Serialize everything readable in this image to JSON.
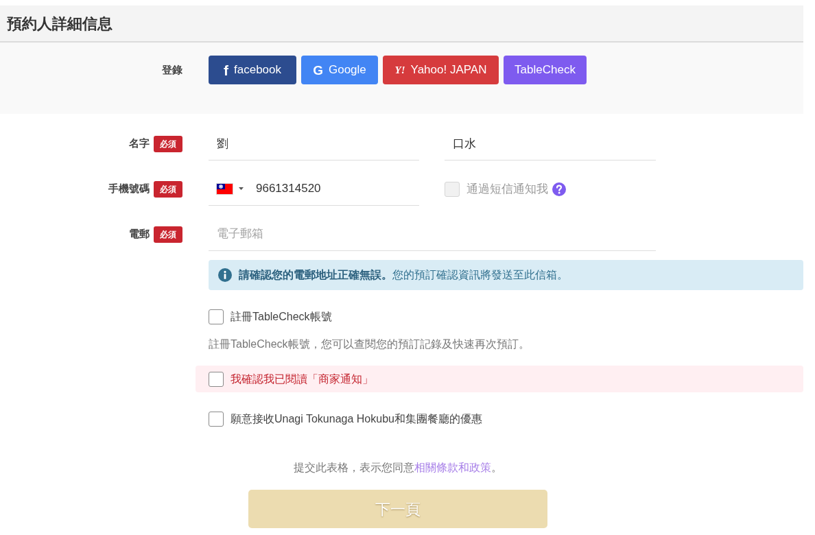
{
  "header": {
    "title": "預約人詳細信息"
  },
  "login": {
    "label": "登錄",
    "providers": [
      {
        "kind": "facebook",
        "logo": "f",
        "label": "facebook"
      },
      {
        "kind": "google",
        "logo": "G",
        "label": "Google"
      },
      {
        "kind": "yahoo",
        "logo": "Y!",
        "label": "Yahoo! JAPAN"
      },
      {
        "kind": "tablecheck",
        "label": "TableCheck"
      }
    ]
  },
  "name_row": {
    "label": "名字",
    "badge": "必須",
    "first_name": {
      "value": "劉"
    },
    "last_name": {
      "value": "口水"
    }
  },
  "phone_row": {
    "label": "手機號碼",
    "badge": "必須",
    "phone": {
      "value": "9661314520"
    },
    "sms_notify": {
      "label": "通過短信通知我",
      "checked": false,
      "disabled": true
    }
  },
  "email_row": {
    "label": "電郵",
    "badge": "必須",
    "email": {
      "placeholder": "電子郵箱"
    }
  },
  "email_notice": "**請確認您的電郵地址正確無誤。**您的預訂確認資訊將發送至此信箱。",
  "options": [
    {
      "kind": "plain",
      "label": "註冊TableCheck帳號",
      "checked": false,
      "hint": "註冊TableCheck帳號，您可以查閱您的預訂記錄及快速再次預訂。"
    },
    {
      "kind": "alert",
      "label": "我確認我已閱讀「商家通知」",
      "checked": false
    },
    {
      "kind": "plain",
      "label": "願意接收Unagi Tokunaga Hokubu和集團餐廳的優惠",
      "checked": false
    }
  ],
  "terms": {
    "text": "提交此表格，表示您同意",
    "link": "相關條款和政策",
    "end": "。"
  },
  "next_button": {
    "label": "下一頁",
    "disabled": true
  }
}
